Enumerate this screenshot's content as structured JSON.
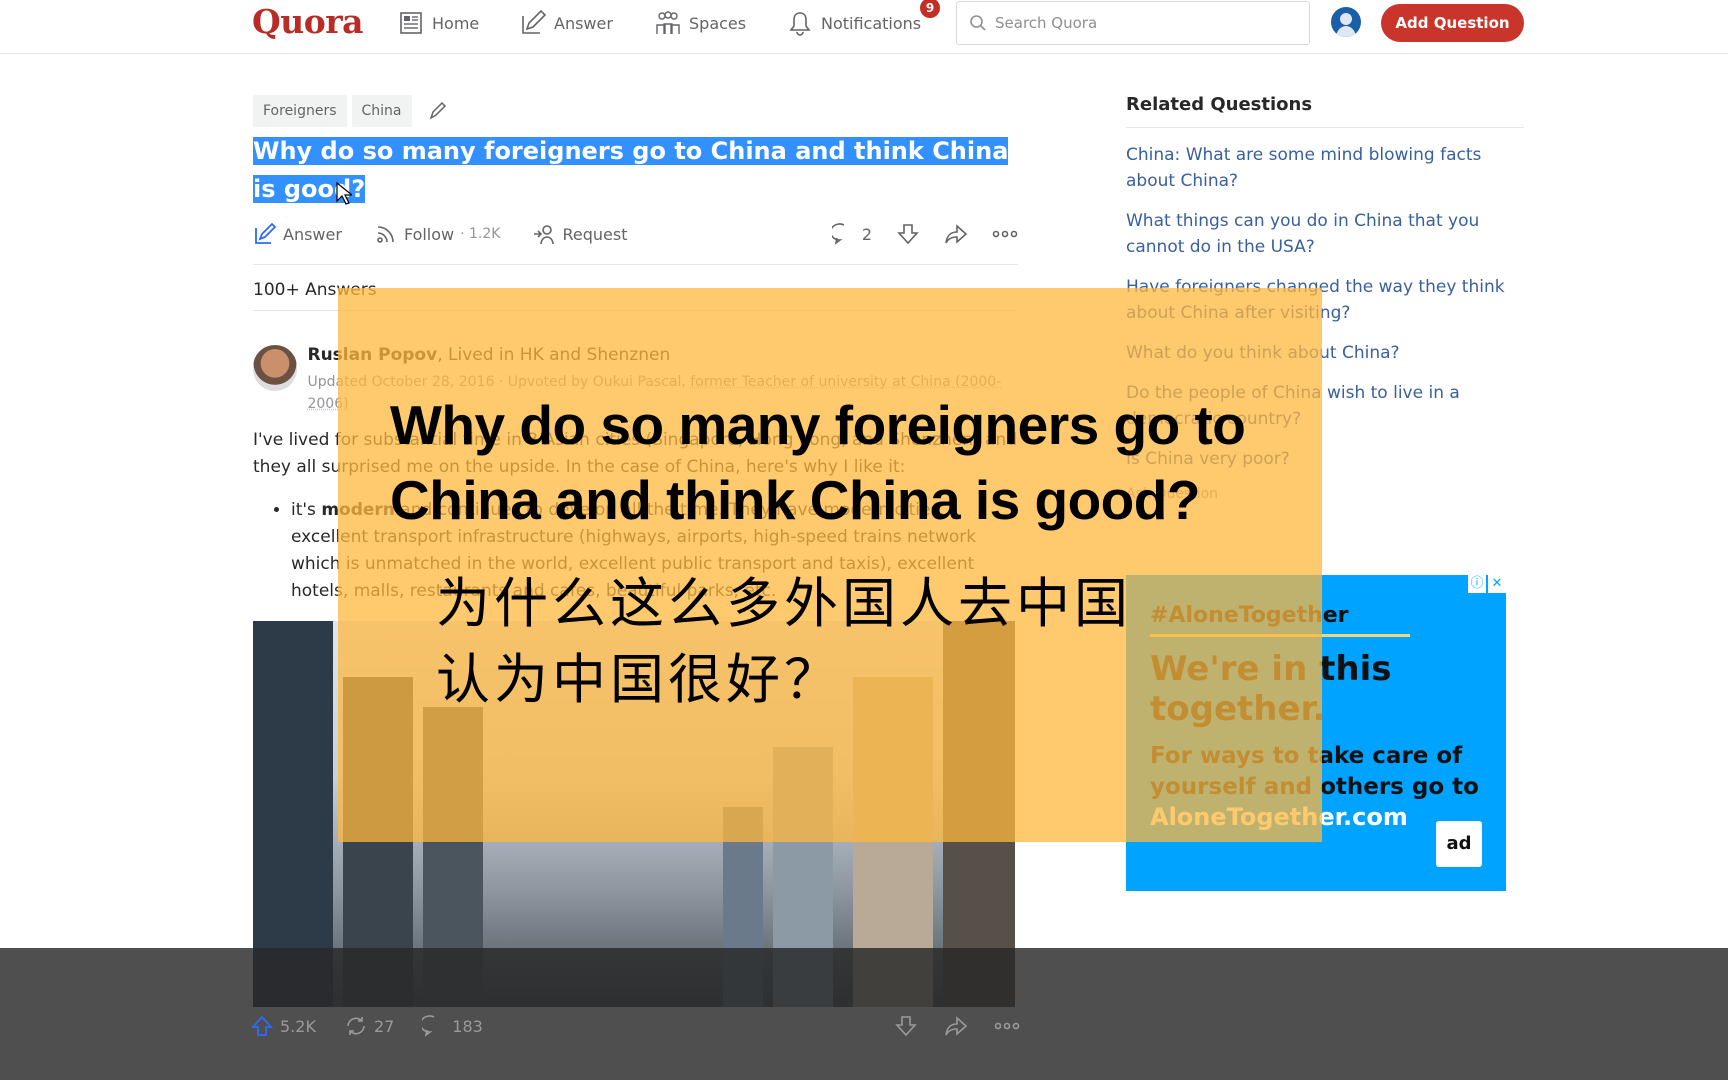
{
  "header": {
    "logo": "Quora",
    "nav": [
      {
        "label": "Home",
        "icon": "home-feed-icon"
      },
      {
        "label": "Answer",
        "icon": "pencil-square-icon"
      },
      {
        "label": "Spaces",
        "icon": "people-icon"
      },
      {
        "label": "Notifications",
        "icon": "bell-icon"
      }
    ],
    "notification_count": "9",
    "search_placeholder": "Search Quora",
    "add_question_label": "Add Question"
  },
  "question": {
    "topics": [
      "Foreigners",
      "China"
    ],
    "title": "Why do so many foreigners go to China and think China is good?",
    "actions": {
      "answer": "Answer",
      "follow": "Follow",
      "follow_count": "· 1.2K",
      "request": "Request",
      "comment_count": "2"
    },
    "answers_count": "100+ Answers"
  },
  "answer": {
    "author_name": "Ruslan Popov",
    "author_credential": ", Lived in HK and Shenznen",
    "meta_prefix": "Updated October 28, 2016 · Upvoted by Oukui Pascal, ",
    "meta_credential": "former Teacher of university at China (2000-2006)",
    "paragraph": "I've lived for substantial time in 3 Asian cities (Singapore, Hong Kong, and Shenzhen) and they all surprised me on the upside. In the case of China, here's why I like it:",
    "bullet_lead": "it's ",
    "bullet_bold": "modern",
    "bullet_rest": " and continues to develop all the time. They have modern cities, excellent transport infrastructure (highways, airports, high-speed trains network which is unmatched in the world, excellent public transport and taxis), excellent hotels, malls, restaurants and cafes, beautiful parks, etc.",
    "stats": {
      "upvotes": "5.2K",
      "shares": "27",
      "comments": "183"
    }
  },
  "sidebar": {
    "title": "Related Questions",
    "questions": [
      "China: What are some mind blowing facts about China?",
      "What things can you do in China that you cannot do in the USA?",
      "Have foreigners changed the way they think about China after visiting?",
      "What do you think about China?",
      "Do the people of China wish to live in a democratic country?",
      "Is China very poor?"
    ],
    "ask_question": "Ask Question"
  },
  "ad": {
    "brand": "#AloneTogether",
    "headline": "We're in this together.",
    "body": "For ways to take care of yourself and others go to",
    "url": "AloneTogether.com",
    "badge": "ad",
    "info_icon": "ⓘ",
    "close_icon": "✕"
  },
  "video_overlay": {
    "caption_en_line1": "Why do so many foreigners go to",
    "caption_en_line2": "China and think China is good?",
    "caption_zh_line1": "为什么这么多外国人去中国",
    "caption_zh_line2": "认为中国很好？"
  },
  "colors": {
    "brand": "#b92b27",
    "selection": "#3390ff",
    "overlay": "#ffb73d",
    "ad_background": "#00a3ff",
    "link": "#39609e"
  }
}
